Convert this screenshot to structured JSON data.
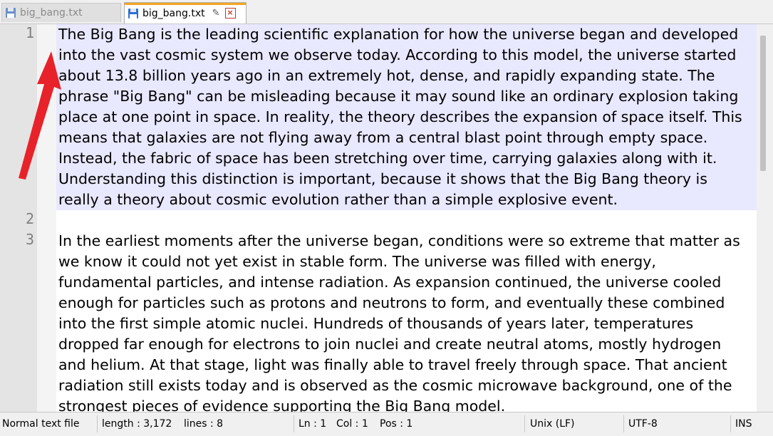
{
  "tabs": [
    {
      "label": "big_bang.txt",
      "active": false
    },
    {
      "label": "big_bang.txt",
      "active": true
    }
  ],
  "editor": {
    "line_numbers": [
      "1",
      "2",
      "3"
    ],
    "lines": [
      "The Big Bang is the leading scientific explanation for how the universe began and developed into the vast cosmic system we observe today. According to this model, the universe started about 13.8 billion years ago in an extremely hot, dense, and rapidly expanding state. The phrase \"Big Bang\" can be misleading because it may sound like an ordinary explosion taking place at one point in space. In reality, the theory describes the expansion of space itself. This means that galaxies are not flying away from a central blast point through empty space. Instead, the fabric of space has been stretching over time, carrying galaxies along with it. Understanding this distinction is important, because it shows that the Big Bang theory is really a theory about cosmic evolution rather than a simple explosive event.",
      "",
      "In the earliest moments after the universe began, conditions were so extreme that matter as we know it could not yet exist in stable form. The universe was filled with energy, fundamental particles, and intense radiation. As expansion continued, the universe cooled enough for particles such as protons and neutrons to form, and eventually these combined into the first simple atomic nuclei. Hundreds of thousands of years later, temperatures dropped far enough for electrons to join nuclei and create neutral atoms, mostly hydrogen and helium. At that stage, light was finally able to travel freely through space. That ancient radiation still exists today and is observed as the cosmic microwave background, one of the strongest pieces of evidence supporting the Big Bang model."
    ]
  },
  "statusbar": {
    "file_type": "Normal text file",
    "length": "length : 3,172",
    "lines": "lines : 8",
    "ln": "Ln : 1",
    "col": "Col : 1",
    "pos": "Pos : 1",
    "eol": "Unix (LF)",
    "encoding": "UTF-8",
    "mode": "INS"
  },
  "colors": {
    "current_line": "#e8e8ff",
    "active_tab_accent": "#f5a623",
    "annotation_arrow": "#e8222a"
  }
}
